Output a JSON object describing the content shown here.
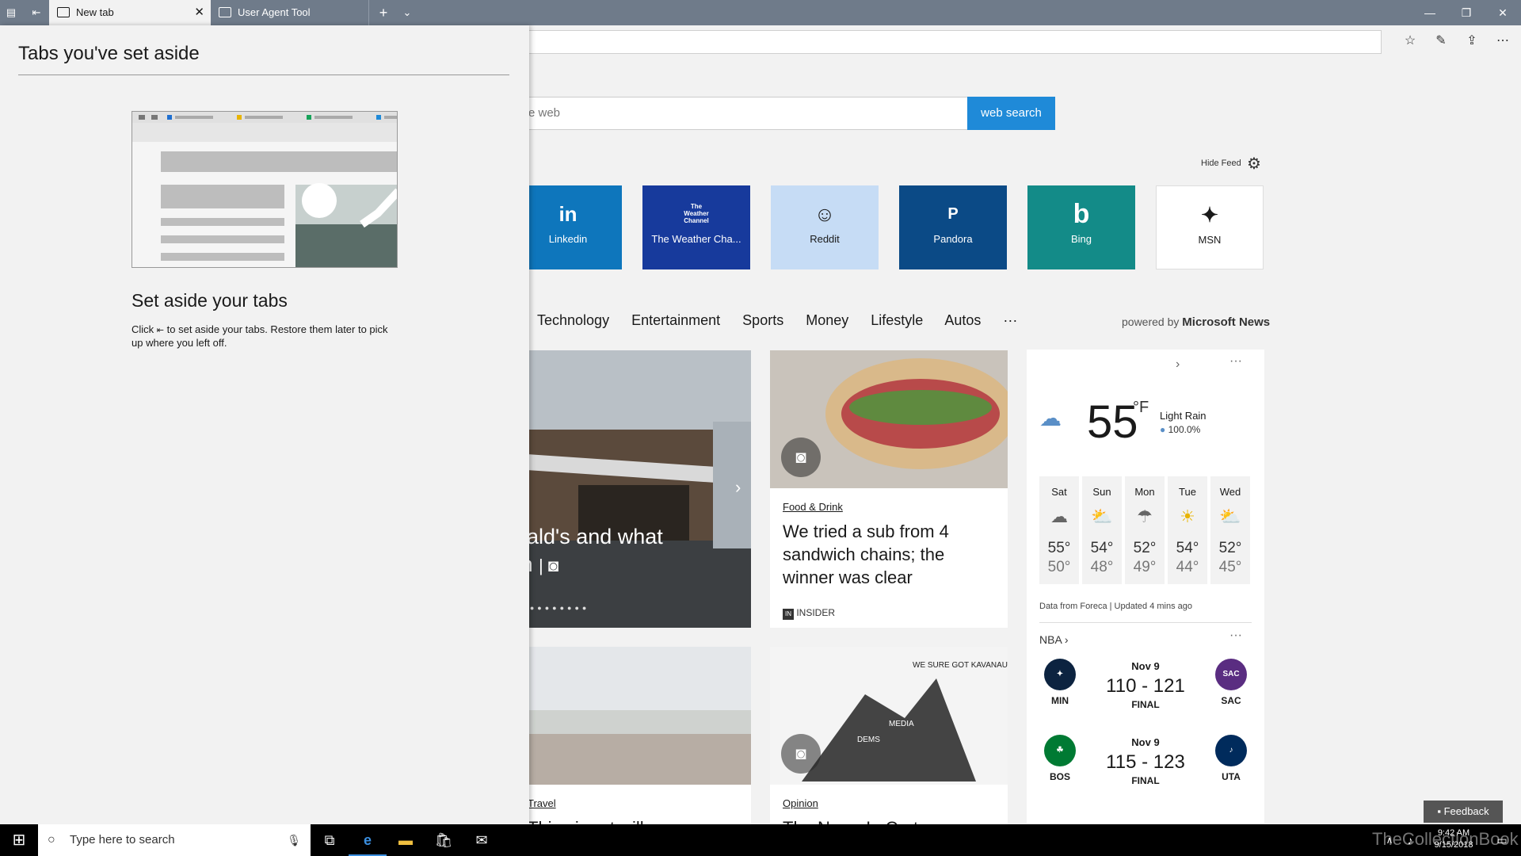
{
  "browser": {
    "tabs": [
      {
        "label": "New tab",
        "active": true
      },
      {
        "label": "User Agent Tool",
        "active": false
      }
    ],
    "new_tab_icon": "plus-icon",
    "tab_list_icon": "chevron-down-icon"
  },
  "aside_panel": {
    "title": "Tabs you've set aside",
    "heading": "Set aside your tabs",
    "desc_before": "Click",
    "desc_after": "to set aside your tabs. Restore them later to pick up where you left off."
  },
  "search": {
    "placeholder": "e web",
    "button_label": "web search"
  },
  "feed": {
    "hide_label": "Hide Feed"
  },
  "tiles": [
    {
      "label": "Linkedin",
      "logo": "in",
      "bg": "#0e76bc"
    },
    {
      "label": "The Weather Cha...",
      "logo": "The Weather Channel",
      "bg": "#173a9c"
    },
    {
      "label": "Reddit",
      "logo": "☺",
      "bg": "#c6dcf5"
    },
    {
      "label": "Pandora",
      "logo": "P",
      "bg": "#0b4a86"
    },
    {
      "label": "Bing",
      "logo": "b",
      "bg": "#138b88"
    },
    {
      "label": "MSN",
      "logo": "✦",
      "bg": "#ffffff"
    }
  ],
  "categories": [
    "Technology",
    "Entertainment",
    "Sports",
    "Money",
    "Lifestyle",
    "Autos",
    "···"
  ],
  "powered": {
    "prefix": "powered by",
    "brand": "Microsoft News"
  },
  "cards": {
    "main": {
      "text_line1": "nald's and what",
      "text_line2": "th"
    },
    "food": {
      "category": "Food & Drink",
      "title": "We tried a sub from 4 sandwich chains; the winner was clear",
      "source": "INSIDER"
    },
    "travel": {
      "category": "Travel",
      "title": "This airport will soon"
    },
    "opinion": {
      "category": "Opinion",
      "title": "The News In Cartoons",
      "cartoon_text": "WE SURE GOT KAVANAUGH",
      "cartoon_label1": "DEMS",
      "cartoon_label2": "MEDIA"
    }
  },
  "weather": {
    "temp": "55",
    "unit": "°F",
    "condition": "Light Rain",
    "precip": "100.0%",
    "days": [
      {
        "name": "Sat",
        "hi": "55°",
        "lo": "50°",
        "icon": "☁"
      },
      {
        "name": "Sun",
        "hi": "54°",
        "lo": "48°",
        "icon": "⛅"
      },
      {
        "name": "Mon",
        "hi": "52°",
        "lo": "49°",
        "icon": "☂"
      },
      {
        "name": "Tue",
        "hi": "54°",
        "lo": "44°",
        "icon": "☀"
      },
      {
        "name": "Wed",
        "hi": "52°",
        "lo": "45°",
        "icon": "⛅"
      }
    ],
    "source": "Data from Foreca | Updated 4 mins ago"
  },
  "nba": {
    "title": "NBA",
    "games": [
      {
        "date": "Nov 9",
        "score": "110 - 121",
        "status": "FINAL",
        "home": "MIN",
        "away": "SAC",
        "home_color": "#0c2340",
        "away_color": "#5a2d81"
      },
      {
        "date": "Nov 9",
        "score": "115 - 123",
        "status": "FINAL",
        "home": "BOS",
        "away": "UTA",
        "home_color": "#007a33",
        "away_color": "#002b5c"
      }
    ]
  },
  "feedback_label": "Feedback",
  "taskbar": {
    "search_placeholder": "Type here to search",
    "time": "9:42 AM",
    "date": "9/15/2018"
  },
  "watermark": "TheCollectionBook"
}
